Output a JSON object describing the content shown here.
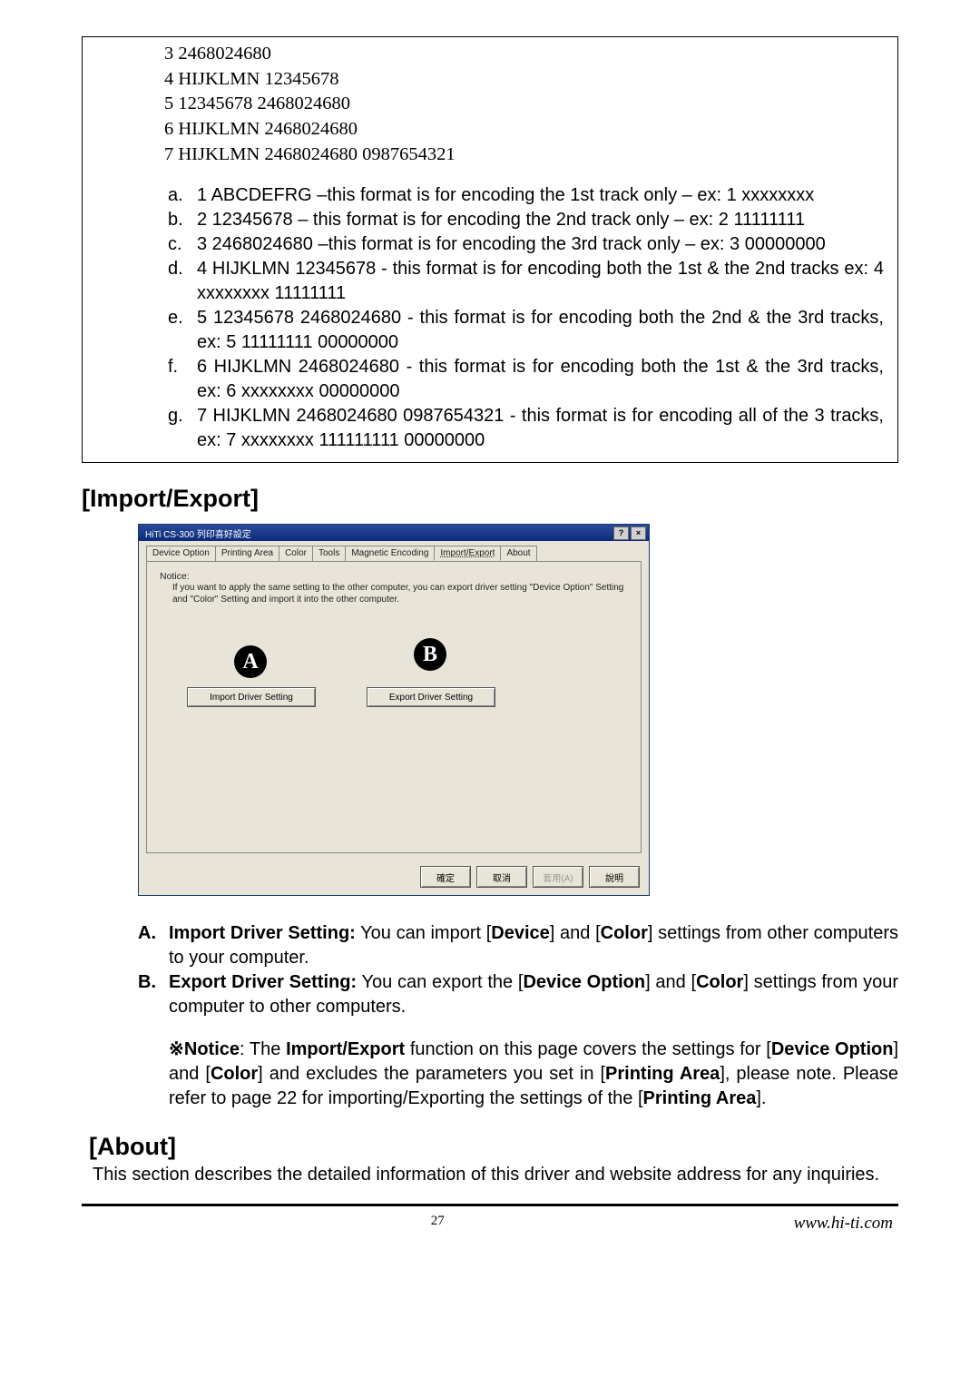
{
  "box": {
    "formats": [
      "3 2468024680",
      "4 HIJKLMN 12345678",
      "5 12345678 2468024680",
      "6 HIJKLMN 2468024680",
      "7 HIJKLMN 2468024680 0987654321"
    ],
    "items": [
      {
        "m": "a.",
        "t": "1 ABCDEFRG –this format is for encoding the 1st track only – ex: 1 xxxxxxxx"
      },
      {
        "m": "b.",
        "t": "2 12345678 – this format is for encoding the 2nd track only – ex: 2 11111111"
      },
      {
        "m": "c.",
        "t": "3 2468024680 –this format is for encoding the 3rd track only – ex: 3 00000000"
      },
      {
        "m": "d.",
        "t": "4 HIJKLMN 12345678 - this format is for encoding both the 1st & the 2nd tracks ex: 4 xxxxxxxx 11111111"
      },
      {
        "m": "e.",
        "t": "5 12345678 2468024680 - this format is for encoding both the 2nd & the 3rd tracks, ex: 5 11111111 00000000"
      },
      {
        "m": "f.",
        "t": "6 HIJKLMN 2468024680 - this format is for encoding both the 1st & the 3rd tracks, ex: 6 xxxxxxxx 00000000"
      },
      {
        "m": "g.",
        "t": "7 HIJKLMN 2468024680 0987654321 - this format is for encoding all of the 3 tracks, ex: 7 xxxxxxxx 111111111 00000000"
      }
    ]
  },
  "sections": {
    "import_export": "[Import/Export]",
    "about": "[About]"
  },
  "dialog": {
    "title": "HiTi CS-300 列印喜好設定",
    "winbtns": {
      "help": "?",
      "close": "×"
    },
    "tabs": [
      "Device Option",
      "Printing Area",
      "Color",
      "Tools",
      "Magnetic Encoding",
      "Import/Export",
      "About"
    ],
    "active_tab": 5,
    "notice_label": "Notice:",
    "notice_text": "If you want to apply the same setting to the other computer, you can export driver setting \"Device Option\" Setting and \"Color\" Setting and import it into the other computer.",
    "badge_a": "A",
    "badge_b": "B",
    "import_btn": "Import Driver Setting",
    "export_btn": "Export Driver Setting",
    "bottom": {
      "ok": "確定",
      "cancel": "取消",
      "apply": "套用(A)",
      "help": "說明"
    }
  },
  "desc": {
    "a_marker": "A.",
    "a_lead": "Import Driver Setting:",
    "a_rest_1": " You can import [",
    "a_b1": "Device",
    "a_rest_2": "] and [",
    "a_b2": "Color",
    "a_rest_3": "] settings from other computers to your computer.",
    "b_marker": "B.",
    "b_lead": "Export Driver Setting:",
    "b_rest_1": " You can export the [",
    "b_b1": "Device Option",
    "b_rest_2": "] and [",
    "b_b2": "Color",
    "b_rest_3": "] settings from your computer to other computers."
  },
  "notice_para": {
    "lead": "※Notice",
    "p1": ": The ",
    "b1": "Import/Export",
    "p2": " function on this page covers the settings for [",
    "b2": "Device Option",
    "p3": "] and [",
    "b3": "Color",
    "p4": "] and excludes the parameters you set in [",
    "b4": "Printing Area",
    "p5": "], please note. Please refer to page 22 for importing/Exporting the settings of the [",
    "b5": "Printing Area",
    "p6": "]."
  },
  "about_intro": "This section describes the detailed information of this driver and website address for any inquiries.",
  "footer": {
    "page": "27",
    "url": "www.hi-ti.com"
  }
}
